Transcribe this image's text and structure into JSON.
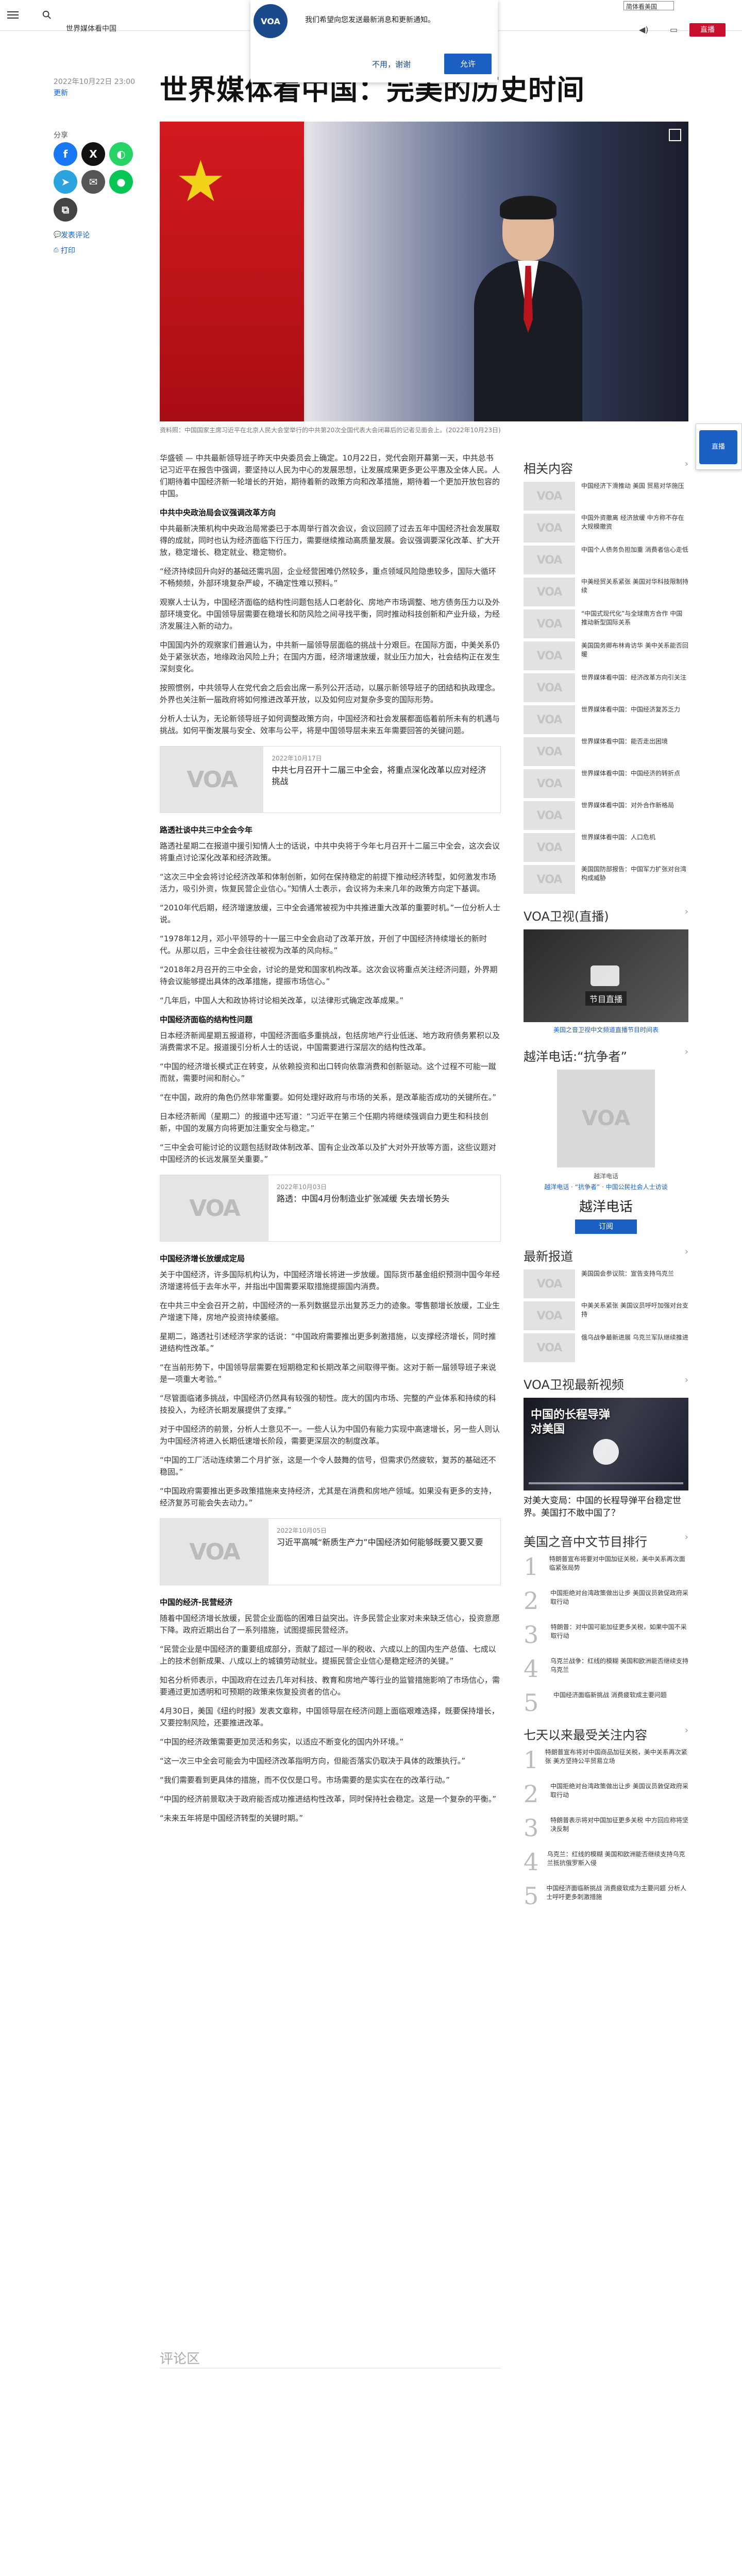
{
  "header": {
    "category": "世界媒体看中国",
    "language_select": "简体看美国",
    "live_label": "直播"
  },
  "consent": {
    "message": "我们希望向您发送最新消息和更新通知。",
    "decline": "不用，谢谢",
    "accept": "允许"
  },
  "article": {
    "date": "2022年10月22日 23:00",
    "updated": "更新",
    "headline": "世界媒体看中国：完美的历史时间",
    "share_label": "分享",
    "comment_link": "发表评论",
    "print_link": "打印",
    "caption": "资料照：中国国家主席习近平在北京人民大会堂举行的中共第20次全国代表大会闭幕后的记者见面会上。(2022年10月23日)",
    "body": [
      {
        "type": "p",
        "text": "华盛顿 — 中共最新领导班子昨天中央委员会上确定。10月22日，党代会刚开幕第一天，中共总书记习近平在报告中强调，要坚持以人民为中心的发展思想，让发展成果更多更公平惠及全体人民。人们期待着中国经济新一轮增长的开始，期待着新的政策方向和改革措施，期待着一个更加开放包容的中国。"
      },
      {
        "type": "h",
        "text": "中共中央政治局会议强调改革方向"
      },
      {
        "type": "p",
        "text": "中共最新决策机构中央政治局常委已于本周举行首次会议，会议回顾了过去五年中国经济社会发展取得的成就，同时也认为经济面临下行压力，需要继续推动高质量发展。会议强调要深化改革、扩大开放，稳定增长、稳定就业、稳定物价。"
      },
      {
        "type": "p",
        "text": "“经济持续回升向好的基础还需巩固，企业经营困难仍然较多，重点领域风险隐患较多，国际大循环不畅频频，外部环境复杂严峻，不确定性难以预料。”"
      },
      {
        "type": "p",
        "text": "观察人士认为，中国经济面临的结构性问题包括人口老龄化、房地产市场调整、地方债务压力以及外部环境变化。中国领导层需要在稳增长和防风险之间寻找平衡，同时推动科技创新和产业升级，为经济发展注入新的动力。"
      },
      {
        "type": "p",
        "text": "中国国内外的观察家们普遍认为，中共新一届领导层面临的挑战十分艰巨。在国际方面，中美关系仍处于紧张状态，地缘政治风险上升；在国内方面，经济增速放缓，就业压力加大，社会结构正在发生深刻变化。"
      },
      {
        "type": "p",
        "text": "按照惯例，中共领导人在党代会之后会出席一系列公开活动，以展示新领导班子的团结和执政理念。外界也关注新一届政府将如何推进改革开放，以及如何应对复杂多变的国际形势。"
      },
      {
        "type": "p",
        "text": "分析人士认为，无论新领导班子如何调整政策方向，中国经济和社会发展都面临着前所未有的机遇与挑战。如何平衡发展与安全、效率与公平，将是中国领导层未来五年需要回答的关键问题。"
      },
      {
        "type": "card",
        "date": "2022年10月17日",
        "title": "中共七月召开十二届三中全会，将重点深化改革以应对经济挑战"
      },
      {
        "type": "h",
        "text": "路透社谈中共三中全会今年"
      },
      {
        "type": "p",
        "text": "路透社星期二在报道中援引知情人士的话说，中共中央将于今年七月召开十二届三中全会，这次会议将重点讨论深化改革和经济政策。"
      },
      {
        "type": "p",
        "text": "“这次三中全会将讨论经济改革和体制创新，如何在保持稳定的前提下推动经济转型，如何激发市场活力，吸引外资，恢复民营企业信心。”知情人士表示，会议将为未来几年的政策方向定下基调。"
      },
      {
        "type": "p",
        "text": "“2010年代后期，经济增速放缓，三中全会通常被视为中共推进重大改革的重要时机。”一位分析人士说。"
      },
      {
        "type": "p",
        "text": "“1978年12月，邓小平领导的十一届三中全会启动了改革开放，开创了中国经济持续增长的新时代。从那以后，三中全会往往被视为改革的风向标。”"
      },
      {
        "type": "p",
        "text": "“2018年2月召开的三中全会，讨论的是党和国家机构改革。这次会议将重点关注经济问题，外界期待会议能够提出具体的改革措施，提振市场信心。”"
      },
      {
        "type": "p",
        "text": "“几年后，中国人大和政协将讨论相关改革，以法律形式确定改革成果。”"
      },
      {
        "type": "h",
        "text": "中国经济面临的结构性问题"
      },
      {
        "type": "p",
        "text": "日本经济新闻星期五报道称，中国经济面临多重挑战，包括房地产行业低迷、地方政府债务累积以及消费需求不足。报道援引分析人士的话说，中国需要进行深层次的结构性改革。"
      },
      {
        "type": "p",
        "text": "“中国的经济增长模式正在转变，从依赖投资和出口转向依靠消费和创新驱动。这个过程不可能一蹴而就，需要时间和耐心。”"
      },
      {
        "type": "p",
        "text": "“在中国，政府的角色仍然非常重要。如何处理好政府与市场的关系，是改革能否成功的关键所在。”"
      },
      {
        "type": "p",
        "text": "日本经济新闻（星期二）的报道中还写道：“习近平在第三个任期内将继续强调自力更生和科技创新，中国的发展方向将更加注重安全与稳定。”"
      },
      {
        "type": "p",
        "text": "“三中全会可能讨论的议题包括财政体制改革、国有企业改革以及扩大对外开放等方面，这些议题对中国经济的长远发展至关重要。”"
      },
      {
        "type": "card",
        "date": "2022年10月03日",
        "title": "路透：中国4月份制造业扩张减缓 失去增长势头"
      },
      {
        "type": "h",
        "text": "中国经济增长放缓成定局"
      },
      {
        "type": "p",
        "text": "关于中国经济，许多国际机构认为，中国经济增长将进一步放缓。国际货币基金组织预测中国今年经济增速将低于去年水平，并指出中国需要采取措施提振国内消费。"
      },
      {
        "type": "p",
        "text": "在中共三中全会召开之前，中国经济的一系列数据显示出复苏乏力的迹象。零售额增长放缓，工业生产增速下降，房地产投资持续萎缩。"
      },
      {
        "type": "p",
        "text": "星期二，路透社引述经济学家的话说：“中国政府需要推出更多刺激措施，以支撑经济增长，同时推进结构性改革。”"
      },
      {
        "type": "p",
        "text": "“在当前形势下，中国领导层需要在短期稳定和长期改革之间取得平衡。这对于新一届领导班子来说是一项重大考验。”"
      },
      {
        "type": "p",
        "text": "“尽管面临诸多挑战，中国经济仍然具有较强的韧性。庞大的国内市场、完整的产业体系和持续的科技投入，为经济长期发展提供了支撑。”"
      },
      {
        "type": "p",
        "text": "对于中国经济的前景，分析人士意见不一。一些人认为中国仍有能力实现中高速增长，另一些人则认为中国经济将进入长期低速增长阶段，需要更深层次的制度改革。"
      },
      {
        "type": "p",
        "text": "“中国的工厂活动连续第二个月扩张，这是一个令人鼓舞的信号，但需求仍然疲软，复苏的基础还不稳固。”"
      },
      {
        "type": "p",
        "text": "“中国政府需要推出更多政策措施来支持经济，尤其是在消费和房地产领域。如果没有更多的支持，经济复苏可能会失去动力。”"
      },
      {
        "type": "card",
        "date": "2022年10月05日",
        "title": "习近平高喊“新质生产力”中国经济如何能够既要又要又要"
      },
      {
        "type": "h",
        "text": "中国的经济-民营经济"
      },
      {
        "type": "p",
        "text": "随着中国经济增长放缓，民营企业面临的困难日益突出。许多民营企业家对未来缺乏信心，投资意愿下降。政府近期出台了一系列措施，试图提振民营经济。"
      },
      {
        "type": "p",
        "text": "“民营企业是中国经济的重要组成部分，贡献了超过一半的税收、六成以上的国内生产总值、七成以上的技术创新成果、八成以上的城镇劳动就业。提振民营企业信心是稳定经济的关键。”"
      },
      {
        "type": "p",
        "text": "知名分析师表示，中国政府在过去几年对科技、教育和房地产等行业的监管措施影响了市场信心，需要通过更加透明和可预期的政策来恢复投资者的信心。"
      },
      {
        "type": "p",
        "text": "4月30日，美国《纽约时报》发表文章称，中国领导层在经济问题上面临艰难选择，既要保持增长，又要控制风险，还要推进改革。"
      },
      {
        "type": "p",
        "text": "“中国的经济政策需要更加灵活和务实，以适应不断变化的国内外环境。”"
      },
      {
        "type": "p",
        "text": "“这一次三中全会可能会为中国经济改革指明方向，但能否落实仍取决于具体的政策执行。”"
      },
      {
        "type": "p",
        "text": "“我们需要看到更具体的措施，而不仅仅是口号。市场需要的是实实在在的改革行动。”"
      },
      {
        "type": "p",
        "text": "“中国的经济前景取决于政府能否成功推进结构性改革，同时保持社会稳定。这是一个复杂的平衡。”"
      },
      {
        "type": "p",
        "text": "“未来五年将是中国经济转型的关键时期。”"
      }
    ],
    "comments_title": "评论区"
  },
  "sidebar": {
    "related_title": "相关内容",
    "related": [
      "中国经济下滑推动 美国 贸易对华施压",
      "中国外资撤离 经济放缓 中方称不存在大规模撤资",
      "中国个人债务负担加重 消费者信心走低",
      "中美经贸关系紧张 美国对华科技限制持续",
      "“中国式现代化”与全球南方合作 中国推动新型国际关系",
      "美国国务卿布林肯访华 美中关系能否回暖",
      "世界媒体看中国：经济改革方向引关注",
      "世界媒体看中国：中国经济复苏乏力",
      "世界媒体看中国：能否走出困境",
      "世界媒体看中国：中国经济的转折点",
      "世界媒体看中国：对外合作新格局",
      "世界媒体看中国：人口危机",
      "美国国防部报告：中国军力扩张对台湾构成威胁"
    ],
    "live_title": "VOA卫视(直播)",
    "live_video_label": "节目直播",
    "live_note": "美国之音卫视中文频道直播节目时间表",
    "program_title": "越洋电话:“抗争者”",
    "program_name": "越洋电话",
    "program_links": "越洋电话 · “抗争者” · 中国公民社会人士访谈",
    "program_big": "越洋电话",
    "program_button": "订阅",
    "latest_title": "最新报道",
    "latest": [
      "美国国会参议院：宣告支持乌克兰",
      "中美关系紧张 美国议员呼吁加强对台支持",
      "俄乌战争最新进展 乌克兰军队继续推进"
    ],
    "video_title": "VOA卫视最新视频",
    "video_overlay": "中国的长程导弹\n对美国",
    "video_caption": "对美大变局：中国的长程导弹平台稳定世界。美国打不敢中国了？",
    "ranking_title": "美国之音中文节目排行",
    "ranking": [
      "特朗普宣布将要对中国加征关税，美中关系再次面临紧张局势",
      "中国拒绝对台湾政策做出让步 美国议员敦促政府采取行动",
      "特朗普：对中国可能加征更多关税，如果中国不采取行动",
      "乌克兰战争：红线的模糊 美国和欧洲能否继续支持乌克兰",
      "中国经济面临新挑战 消费疲软成主要问题"
    ],
    "recent_title": "七天以来最受关注内容",
    "recent": [
      "特朗普宣布将对中国商品加征关税，美中关系再次紧张 美方坚持公平贸易立场",
      "中国拒绝对台湾政策做出让步 美国议员敦促政府采取行动",
      "特朗普表示将对中国加征更多关税 中方回应称将坚决反制",
      "乌克兰：红线的模糊 美国和欧洲能否继续支持乌克兰抵抗俄罗斯入侵",
      "中国经济面临新挑战 消费疲软成为主要问题 分析人士呼吁更多刺激措施"
    ]
  },
  "float_tab": "直播"
}
